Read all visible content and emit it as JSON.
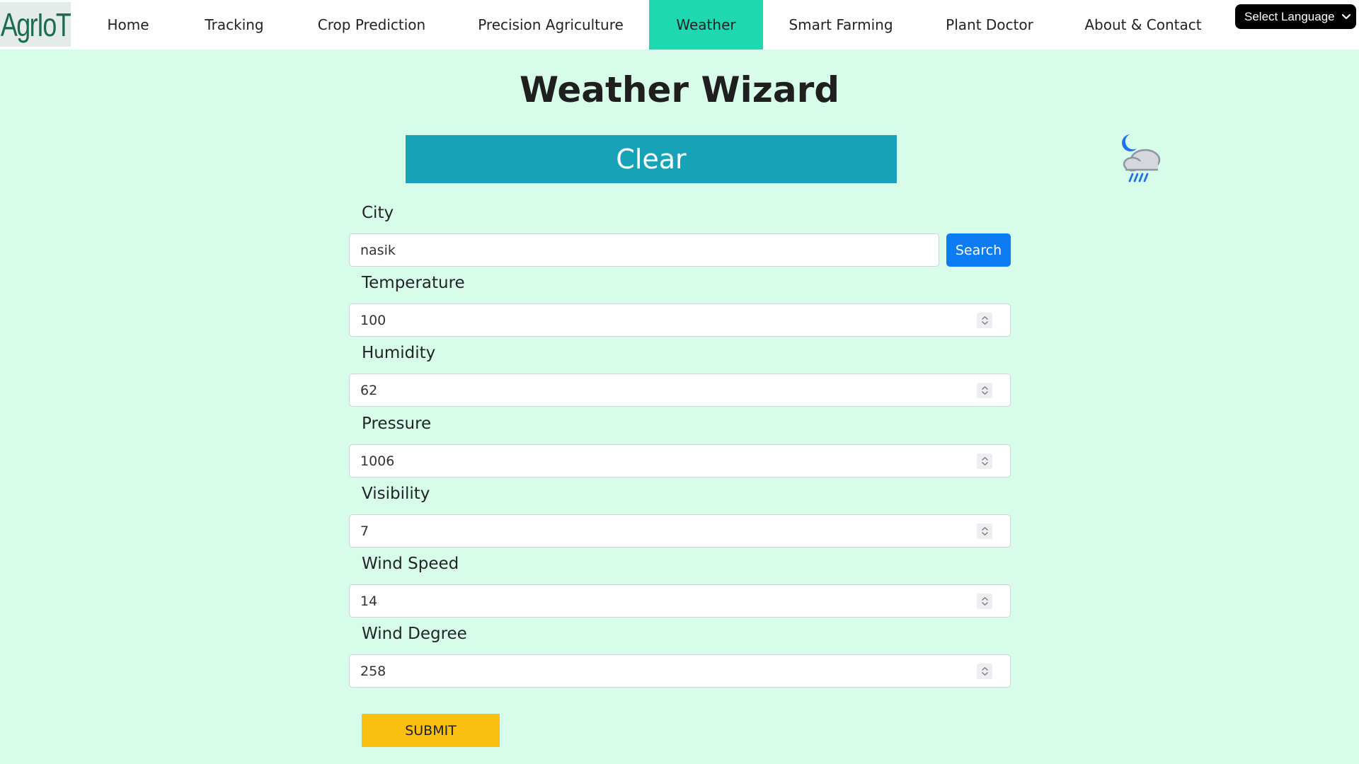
{
  "nav": {
    "logo_text": "AgrIoT",
    "items": [
      {
        "label": "Home"
      },
      {
        "label": "Tracking"
      },
      {
        "label": "Crop Prediction"
      },
      {
        "label": "Precision Agriculture"
      },
      {
        "label": "Weather"
      },
      {
        "label": "Smart Farming"
      },
      {
        "label": "Plant Doctor"
      },
      {
        "label": "About & Contact"
      }
    ],
    "active_item": "Weather",
    "language_select": "Select Language"
  },
  "page": {
    "title": "Weather Wizard",
    "condition": "Clear",
    "condition_icon": "night-rain-cloud-icon"
  },
  "form": {
    "city_label": "City",
    "city_value": "nasik",
    "search_label": "Search",
    "fields": [
      {
        "label": "Temperature",
        "value": "100"
      },
      {
        "label": "Humidity",
        "value": "62"
      },
      {
        "label": "Pressure",
        "value": "1006"
      },
      {
        "label": "Visibility",
        "value": "7"
      },
      {
        "label": "Wind Speed",
        "value": "14"
      },
      {
        "label": "Wind Degree",
        "value": "258"
      }
    ],
    "submit_label": "SUBMIT"
  },
  "colors": {
    "page_bg": "#d8fcea",
    "active_nav": "#1ed8b2",
    "banner": "#17a2b8",
    "search_button": "#0d7cf2",
    "submit_button": "#fbbf0f"
  }
}
